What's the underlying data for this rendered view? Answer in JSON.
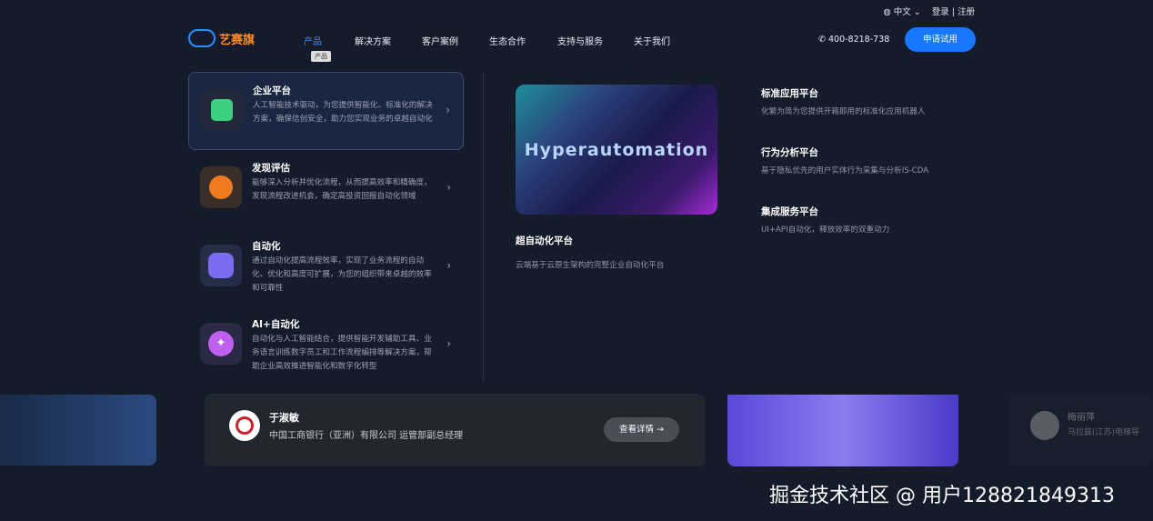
{
  "header": {
    "logo_text": "艺赛旗",
    "nav": [
      "产品",
      "解决方案",
      "客户案例",
      "生态合作",
      "支持与服务",
      "关于我们"
    ],
    "tooltip": "产品",
    "language": "中文",
    "login": "登录 | 注册",
    "phone": "400-8218-738",
    "cta": "申请试用"
  },
  "menu": {
    "items": [
      {
        "title": "企业平台",
        "desc": "人工智能技术驱动，为您提供智能化、标准化的解决方案，确保信创安全，助力您实现业务的卓越自动化"
      },
      {
        "title": "发现评估",
        "desc": "能够深入分析并优化流程，从而提高效率和精确度，发现流程改进机会，确定高投资回报自动化领域"
      },
      {
        "title": "自动化",
        "desc": "通过自动化提高流程效率，实现了业务流程的自动化、优化和高度可扩展，为您的组织带来卓越的效率和可靠性"
      },
      {
        "title": "AI+自动化",
        "desc": "自动化与人工智能结合，提供智能开发辅助工具、业务语言训练数字员工和工作流程编排等解决方案，帮助企业高效推进智能化和数字化转型"
      }
    ],
    "feature": {
      "image_text": "Hyperautomation",
      "title": "超自动化平台",
      "desc": "云端基于云原生架构的完整企业自动化平台"
    },
    "right": [
      {
        "title": "标准应用平台",
        "desc": "化繁为简为您提供开箱即用的标准化应用机器人"
      },
      {
        "title": "行为分析平台",
        "desc": "基于隐私优先的用户实体行为采集与分析IS-CDA"
      },
      {
        "title": "集成服务平台",
        "desc": "UI+API自动化，释放效率的双重动力"
      }
    ]
  },
  "testimonial": {
    "name": "于淑敏",
    "role": "中国工商银行（亚洲）有限公司 运管部副总经理",
    "button": "查看详情",
    "side_name": "梅丽萍",
    "side_role": "马拉兹(江苏)电梯导"
  },
  "watermark": "掘金技术社区 @ 用户128821849313"
}
